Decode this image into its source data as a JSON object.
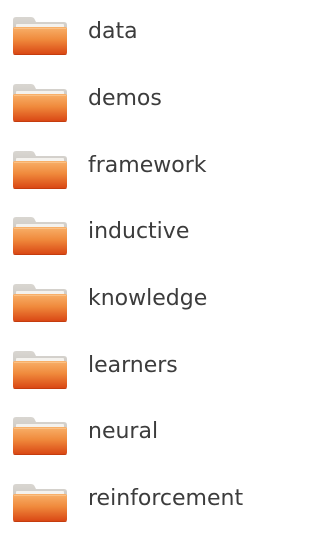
{
  "folders": [
    {
      "name": "data",
      "icon": "folder-icon"
    },
    {
      "name": "demos",
      "icon": "folder-icon"
    },
    {
      "name": "framework",
      "icon": "folder-icon"
    },
    {
      "name": "inductive",
      "icon": "folder-icon"
    },
    {
      "name": "knowledge",
      "icon": "folder-icon"
    },
    {
      "name": "learners",
      "icon": "folder-icon"
    },
    {
      "name": "neural",
      "icon": "folder-icon"
    },
    {
      "name": "reinforcement",
      "icon": "folder-icon"
    }
  ],
  "colors": {
    "folder_top": "#f7a35c",
    "folder_bottom": "#de4a14",
    "folder_tab": "#c9c5bf",
    "folder_paper": "#f4f2ee",
    "label": "#3c3c3c",
    "background": "#ffffff"
  }
}
